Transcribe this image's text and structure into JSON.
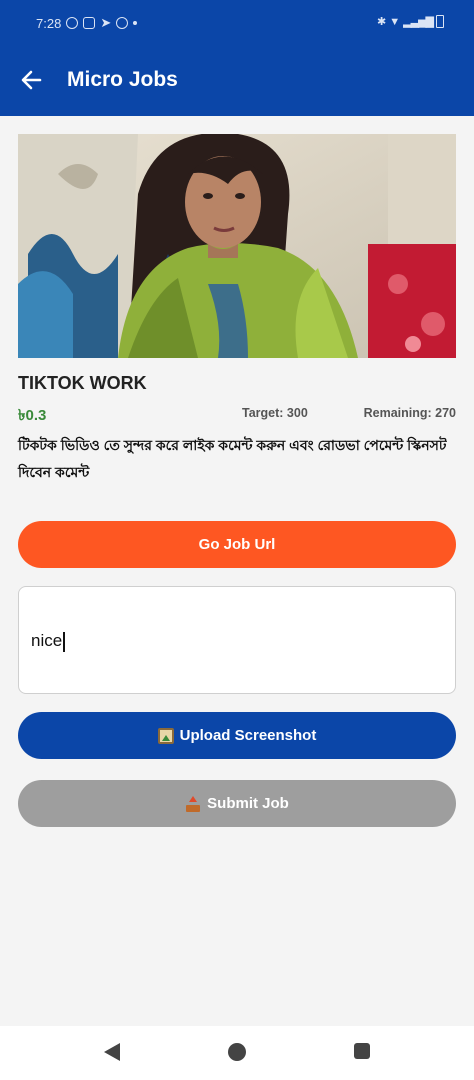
{
  "status_bar": {
    "time": "7:28"
  },
  "app_bar": {
    "title": "Micro Jobs"
  },
  "job": {
    "title": "TIKTOK WORK",
    "price": "৳0.3",
    "target": "Target: 300",
    "remaining": "Remaining: 270",
    "description": "টিকটক ভিডিও তে সুন্দর করে লাইক কমেন্ট করুন এবং  রোডভা পেমেন্ট স্কিনসট দিবেন কমেন্ট"
  },
  "buttons": {
    "go_job_url": "Go Job Url",
    "upload_screenshot": "Upload Screenshot",
    "submit_job": "Submit Job"
  },
  "comment_input": {
    "value": "nice"
  },
  "colors": {
    "primary": "#0b46a8",
    "accent": "#fe5722",
    "disabled": "#9e9e9e",
    "price": "#3a8a3a"
  },
  "icons": {
    "back": "arrow-left-icon",
    "upload": "picture-icon",
    "submit": "outbox-tray-icon"
  }
}
